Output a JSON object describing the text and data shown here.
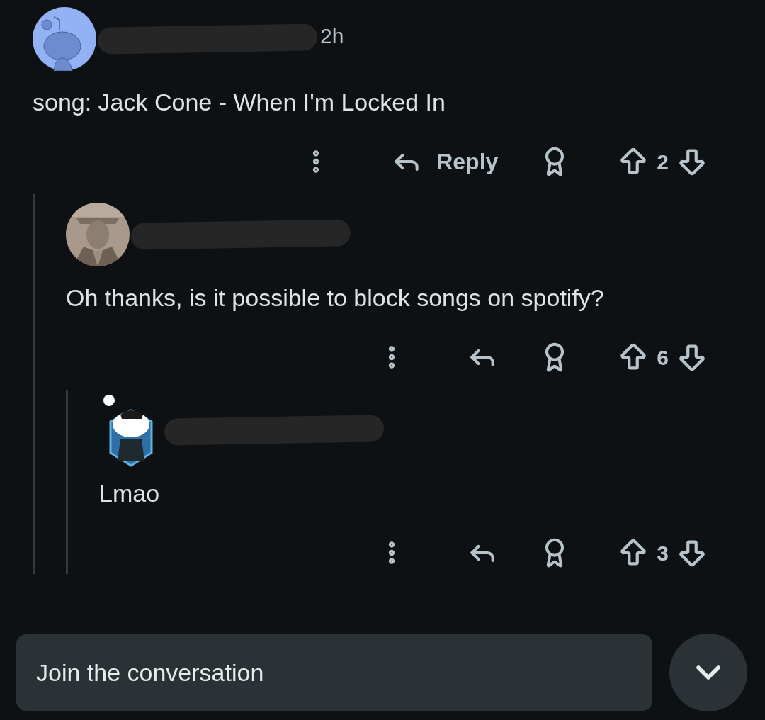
{
  "comments": [
    {
      "avatar": {
        "kind": "snoo"
      },
      "time": "2h",
      "body": "song: Jack Cone - When I'm Locked In",
      "reply_label": "Reply",
      "votes": "2",
      "children": [
        {
          "body": "Oh thanks, is it possible to block songs on spotify?",
          "votes": "6",
          "children": [
            {
              "avatar": {
                "kind": "snoo-badge"
              },
              "body": "Lmao",
              "votes": "3"
            }
          ]
        }
      ]
    }
  ],
  "composer": {
    "placeholder": "Join the conversation"
  }
}
